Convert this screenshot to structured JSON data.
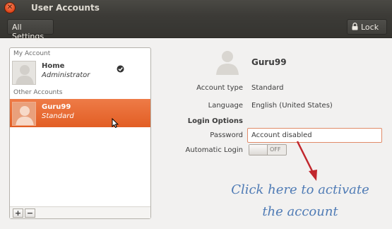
{
  "window": {
    "title": "User Accounts",
    "close_symbol": "✕"
  },
  "toolbar": {
    "all_settings_label": "All Settings",
    "lock_label": "Lock"
  },
  "accounts_panel": {
    "my_account_label": "My Account",
    "other_accounts_label": "Other Accounts",
    "my_account": {
      "name": "Home",
      "role": "Administrator",
      "logged_in": true
    },
    "other_accounts": [
      {
        "name": "Guru99",
        "role": "Standard",
        "selected": true
      }
    ],
    "add_symbol": "+",
    "remove_symbol": "−"
  },
  "details": {
    "name": "Guru99",
    "account_type_label": "Account type",
    "account_type_value": "Standard",
    "language_label": "Language",
    "language_value": "English (United States)",
    "login_options_label": "Login Options",
    "password_label": "Password",
    "password_value": "Account disabled",
    "automatic_login_label": "Automatic Login",
    "automatic_login_state": "OFF"
  },
  "annotation": {
    "line1": "Click here to activate",
    "line2": "the account",
    "color": "#4f7bb5",
    "arrow_color": "#c1272d"
  },
  "colors": {
    "selection": "#e8662e",
    "titlebar": "#3c3b37",
    "window_bg": "#f2f1f0"
  }
}
